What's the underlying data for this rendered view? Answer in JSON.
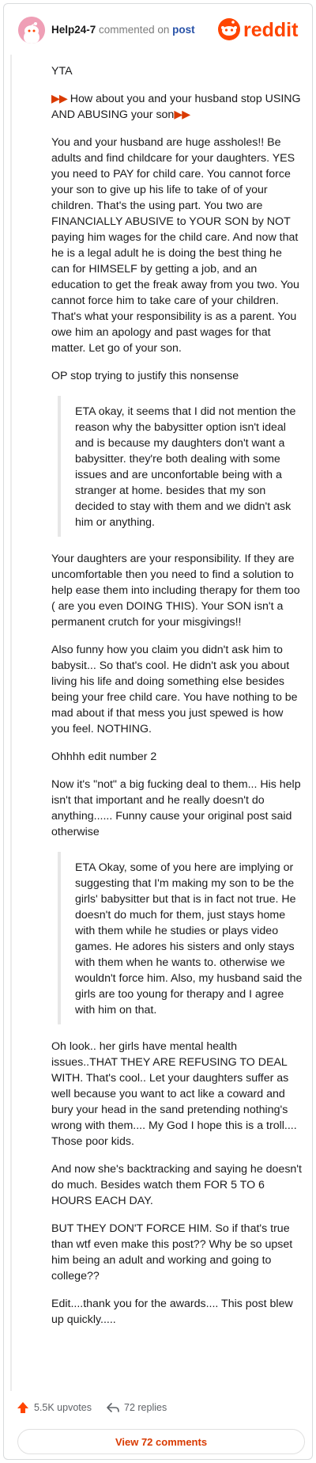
{
  "header": {
    "username": "Help24-7",
    "commented_on": "commented on",
    "post_link": "post",
    "logo_text": "reddit"
  },
  "comment": {
    "p1": "YTA",
    "p2_flags_left": "▶▶",
    "p2": "How about you and your husband stop USING AND ABUSING your son",
    "p2_flags_right": "▶▶",
    "p3": "You and your husband are huge assholes!! Be adults and find childcare for your daughters. YES you need to PAY for child care. You cannot force your son to give up his life to take of of your children. That's the using part. You two are FINANCIALLY ABUSIVE to YOUR SON by NOT paying him wages for the child care. And now that he is a legal adult he is doing the best thing he can for HIMSELF by getting a job, and an education to get the freak away from you two. You cannot force him to take care of your children. That's what your responsibility is as a parent. You owe him an apology and past wages for that matter. Let go of your son.",
    "p4": "OP stop trying to justify this nonsense",
    "quote1": "ETA okay, it seems that I did not mention the reason why the babysitter option isn't ideal and is because my daughters don't want a babysitter. they're both dealing with some issues and are unconfortable being with a stranger at home. besides that my son decided to stay with them and we didn't ask him or anything.",
    "p5": "Your daughters are your responsibility. If they are uncomfortable then you need to find a solution to help ease them into including therapy for them too ( are you even DOING THIS). Your SON isn't a permanent crutch for your misgivings!!",
    "p6": "Also funny how you claim you didn't ask him to babysit... So that's cool. He didn't ask you about living his life and doing something else besides being your free child care. You have nothing to be mad about if that mess you just spewed is how you feel. NOTHING.",
    "p7": "Ohhhh edit number 2",
    "p8": "Now it's \"not\" a big fucking deal to them... His help isn't that important and he really doesn't do anything...... Funny cause your original post said otherwise",
    "quote2": "ETA Okay, some of you here are implying or suggesting that I'm making my son to be the girls' babysitter but that is in fact not true. He doesn't do much for them, just stays home with them while he studies or plays video games. He adores his sisters and only stays with them when he wants to. otherwise we wouldn't force him. Also, my husband said the girls are too young for therapy and I agree with him on that.",
    "p9": "Oh look.. her girls have mental health issues..THAT THEY ARE REFUSING TO DEAL WITH. That's cool.. Let your daughters suffer as well because you want to act like a coward and bury your head in the sand pretending nothing's wrong with them.... My God I hope this is a troll.... Those poor kids.",
    "p10": "And now she's backtracking and saying he doesn't do much. Besides watch them FOR 5 TO 6 HOURS EACH DAY.",
    "p11": "BUT THEY DON'T FORCE HIM. So if that's true than wtf even make this post?? Why be so upset him being an adult and working and going to college??",
    "p12": "Edit....thank you for the awards.... This post blew up quickly....."
  },
  "footer": {
    "upvotes": "5.5K upvotes",
    "replies": "72 replies",
    "view_button": "View 72 comments"
  },
  "colors": {
    "brand": "#ff4500",
    "accent": "#d93a00",
    "link": "#2852a8"
  },
  "icons": {
    "avatar": "snoo-avatar-icon",
    "logo": "reddit-logo-icon",
    "upvote": "upvote-arrow-icon",
    "reply": "reply-arrow-icon",
    "flag": "red-flag-icon"
  }
}
